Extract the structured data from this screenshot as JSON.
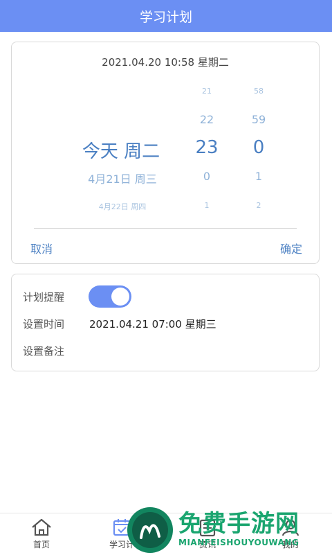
{
  "header": {
    "title": "学习计划"
  },
  "picker": {
    "current": "2021.04.20 10:58 星期二",
    "days": [
      "",
      "",
      "今天 周二",
      "4月21日 周三",
      "4月22日 周四"
    ],
    "hours": [
      "21",
      "22",
      "23",
      "0",
      "1"
    ],
    "minutes": [
      "58",
      "59",
      "0",
      "1",
      "2"
    ],
    "cancel": "取消",
    "confirm": "确定"
  },
  "settings": {
    "reminder_label": "计划提醒",
    "reminder_on": true,
    "time_label": "设置时间",
    "time_value": "2021.04.21 07:00 星期三",
    "note_label": "设置备注"
  },
  "tabs": [
    {
      "label": "首页",
      "icon": "home-icon"
    },
    {
      "label": "学习计",
      "icon": "calendar-check-icon"
    },
    {
      "label": "资讯",
      "icon": "news-icon"
    },
    {
      "label": "我的",
      "icon": "user-icon"
    }
  ],
  "watermark": {
    "title": "免费手游网",
    "subtitle": "MIANFEISHOUYOUWANG"
  },
  "colors": {
    "accent": "#6b8ff3",
    "picker_text": "#4a7fc2",
    "watermark": "#1aa56f"
  }
}
